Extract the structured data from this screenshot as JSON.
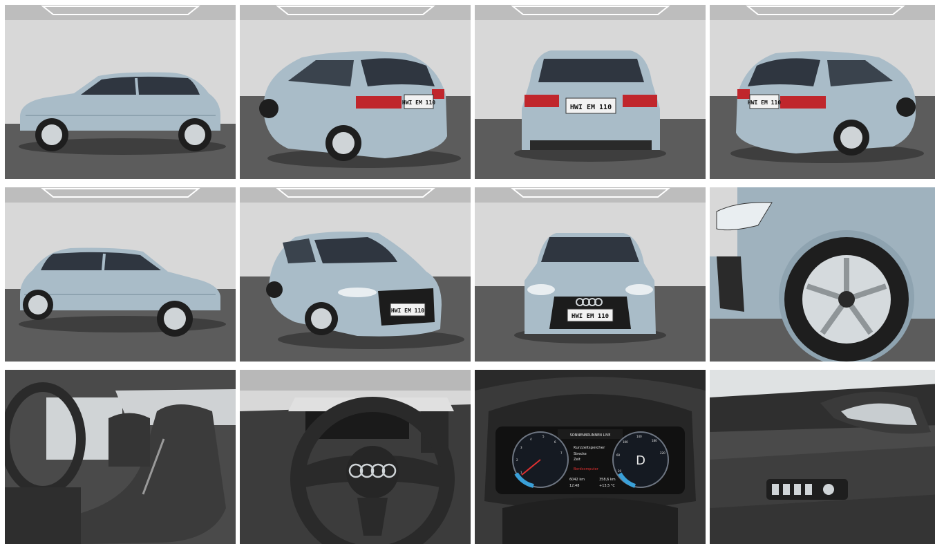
{
  "colors": {
    "body_paint": "#a9bcc8",
    "body_shade": "#8ea3b0",
    "studio_wall": "#d6d6d6",
    "studio_floor": "#5e5e5e",
    "taillight": "#c0262c",
    "interior": "#3a3a3a"
  },
  "plate_text": "HWI EM 110",
  "cluster": {
    "header": "SONNENBRUNNEN LIVE",
    "menu_title": "Kurzzeitspeicher",
    "menu_item_1": "Strecke",
    "menu_item_2": "Zeit",
    "menu_item_3": "Bordcomputer",
    "odometer": "6042 km",
    "clock": "12:48",
    "trip": "358,6 km",
    "temperature": "+13,5 °C",
    "gear": "D",
    "speed_scale": [
      "20",
      "60",
      "100",
      "140",
      "180",
      "220"
    ],
    "rpm_scale": [
      "1",
      "2",
      "3",
      "4",
      "5",
      "6",
      "7"
    ]
  },
  "gallery": [
    {
      "view": "side-left",
      "icon": "car-side-icon"
    },
    {
      "view": "rear-three-quarter-left",
      "icon": "car-rear-icon"
    },
    {
      "view": "rear",
      "icon": "car-rear-icon"
    },
    {
      "view": "rear-three-quarter-right",
      "icon": "car-rear-icon"
    },
    {
      "view": "side-right",
      "icon": "car-side-icon"
    },
    {
      "view": "front-three-quarter-left",
      "icon": "car-front-icon"
    },
    {
      "view": "front",
      "icon": "car-front-icon"
    },
    {
      "view": "wheel-detail",
      "icon": "wheel-icon"
    },
    {
      "view": "front-seats",
      "icon": "seat-icon"
    },
    {
      "view": "steering-wheel",
      "icon": "steering-wheel-icon"
    },
    {
      "view": "instrument-cluster",
      "icon": "gauge-icon"
    },
    {
      "view": "door-panel",
      "icon": "door-icon"
    }
  ]
}
